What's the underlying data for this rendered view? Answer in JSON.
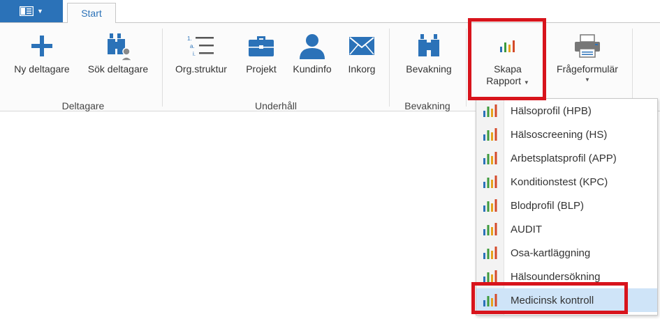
{
  "tabs": [
    {
      "label": "Start",
      "active": true
    }
  ],
  "ribbon": {
    "groups": [
      {
        "label": "Deltagare"
      },
      {
        "label": "Underhåll"
      },
      {
        "label": "Bevakning"
      }
    ],
    "buttons": {
      "ny_deltagare": {
        "label": "Ny deltagare",
        "icon": "plus-icon"
      },
      "sok_deltagare": {
        "label": "Sök deltagare",
        "icon": "binoculars-user-icon"
      },
      "org_struktur": {
        "label": "Org.struktur",
        "icon": "numbered-list-icon"
      },
      "projekt": {
        "label": "Projekt",
        "icon": "briefcase-icon"
      },
      "kundinfo": {
        "label": "Kundinfo",
        "icon": "user-icon"
      },
      "inkorg": {
        "label": "Inkorg",
        "icon": "envelope-icon"
      },
      "bevakning": {
        "label": "Bevakning",
        "icon": "binoculars-icon"
      },
      "skapa_rapport": {
        "label_line1": "Skapa",
        "label_line2": "Rapport",
        "icon": "bar-chart-icon"
      },
      "frageformular": {
        "label": "Frågeformulär",
        "icon": "printer-icon"
      }
    }
  },
  "report_menu": {
    "items": [
      {
        "label": "Hälsoprofil (HPB)"
      },
      {
        "label": "Hälsoscreening (HS)"
      },
      {
        "label": "Arbetsplatsprofil (APP)"
      },
      {
        "label": "Konditionstest (KPC)"
      },
      {
        "label": "Blodprofil (BLP)"
      },
      {
        "label": "AUDIT"
      },
      {
        "label": "Osa-kartläggning"
      },
      {
        "label": "Hälsoundersökning"
      },
      {
        "label": "Medicinsk kontroll",
        "selected": true
      }
    ]
  },
  "colors": {
    "accent": "#2b72b8",
    "highlight": "#d8141c",
    "selected_bg": "#cfe4f8"
  }
}
